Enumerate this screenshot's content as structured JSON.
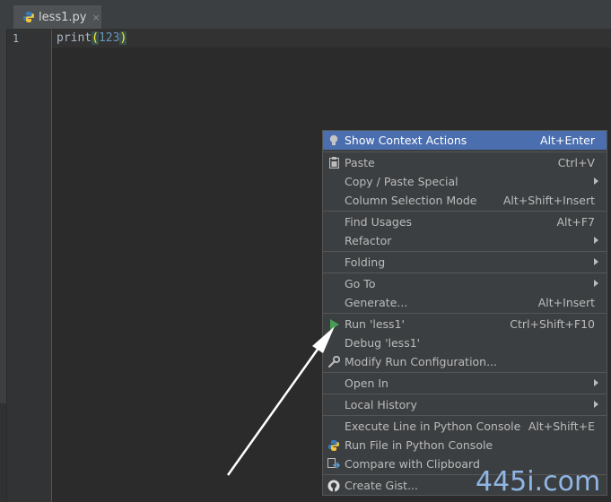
{
  "tab": {
    "label": "less1.py",
    "close": "×"
  },
  "editor": {
    "line_number": "1",
    "code_func": "print",
    "code_open": "(",
    "code_arg": "123",
    "code_close": ")"
  },
  "menu": {
    "show_context_actions": {
      "label": "Show Context Actions",
      "shortcut": "Alt+Enter"
    },
    "paste": {
      "label": "Paste",
      "shortcut": "Ctrl+V"
    },
    "copy_paste_special": {
      "label": "Copy / Paste Special"
    },
    "column_selection": {
      "label": "Column Selection Mode",
      "shortcut": "Alt+Shift+Insert"
    },
    "find_usages": {
      "label": "Find Usages",
      "shortcut": "Alt+F7"
    },
    "refactor": {
      "label": "Refactor"
    },
    "folding": {
      "label": "Folding"
    },
    "go_to": {
      "label": "Go To"
    },
    "generate": {
      "label": "Generate...",
      "shortcut": "Alt+Insert"
    },
    "run": {
      "label": "Run 'less1'",
      "shortcut": "Ctrl+Shift+F10"
    },
    "debug": {
      "label": "Debug 'less1'"
    },
    "modify_run": {
      "label": "Modify Run Configuration..."
    },
    "open_in": {
      "label": "Open In"
    },
    "local_history": {
      "label": "Local History"
    },
    "execute_line": {
      "label": "Execute Line in Python Console",
      "shortcut": "Alt+Shift+E"
    },
    "run_file": {
      "label": "Run File in Python Console"
    },
    "compare_clipboard": {
      "label": "Compare with Clipboard"
    },
    "create_gist": {
      "label": "Create Gist..."
    }
  },
  "watermark": "445i.com",
  "colors": {
    "selection": "#4b6eaf",
    "menu_bg": "#3c3f41",
    "editor_bg": "#2b2b2b",
    "run_green": "#499c54"
  }
}
